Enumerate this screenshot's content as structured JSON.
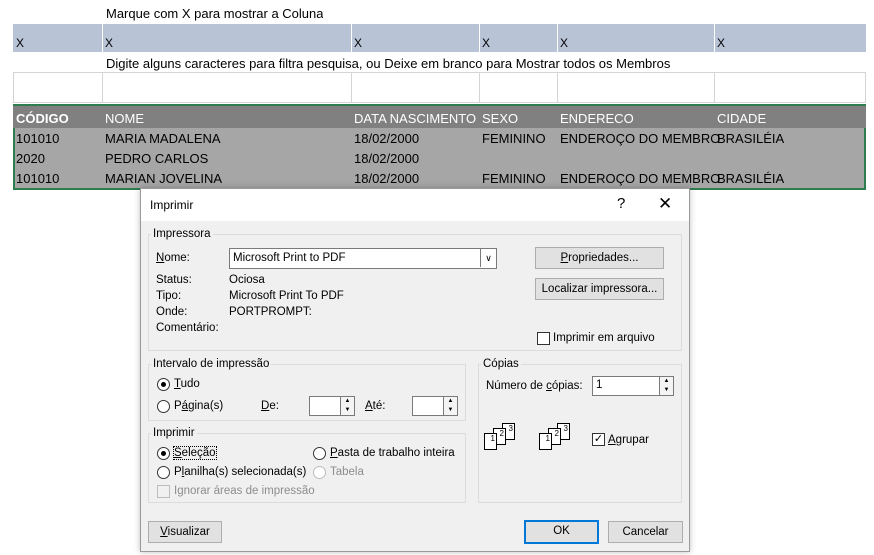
{
  "sheet": {
    "instruction_top": "Marque com X para mostrar a Coluna",
    "x_marks": [
      "X",
      "X",
      "X",
      "X",
      "X",
      "X"
    ],
    "instruction_filter": "Digite alguns caracteres para filtra pesquisa, ou Deixe em branco para Mostrar todos os Membros",
    "headers": [
      "CÓDIGO",
      "NOME",
      "DATA NASCIMENTO",
      "SEXO",
      "ENDERECO",
      "CIDADE"
    ],
    "rows": [
      [
        "101010",
        "MARIA MADALENA",
        "18/02/2000",
        "FEMININO",
        "ENDEROÇO DO MEMBRO",
        "BRASILÉIA"
      ],
      [
        "2020",
        "PEDRO CARLOS",
        "18/02/2000",
        "",
        "",
        ""
      ],
      [
        "101010",
        "MARIAN JOVELINA",
        "18/02/2000",
        "FEMININO",
        "ENDEROÇO DO MEMBRO",
        "BRASILÉIA"
      ]
    ]
  },
  "dialog": {
    "title": "Imprimir",
    "help": "?",
    "close": "✕",
    "printer": {
      "group_label": "Impressora",
      "name_label": "Nome:",
      "name_value": "Microsoft Print to PDF",
      "dropdown_arrow": "∨",
      "status_label": "Status:",
      "status_value": "Ociosa",
      "type_label": "Tipo:",
      "type_value": "Microsoft Print To PDF",
      "where_label": "Onde:",
      "where_value": "PORTPROMPT:",
      "comment_label": "Comentário:",
      "properties_button": "Propriedades...",
      "find_printer_button": "Localizar impressora...",
      "print_to_file_label": "Imprimir em arquivo"
    },
    "range": {
      "group_label": "Intervalo de impressão",
      "all_label": "Tudo",
      "pages_label": "Página(s)",
      "from_label": "De:",
      "to_label": "Até:",
      "from_value": "",
      "to_value": ""
    },
    "copies": {
      "group_label": "Cópias",
      "count_label": "Número de cópias:",
      "count_value": "1",
      "collate_label": "Agrupar",
      "collate_checked": "✓"
    },
    "print_what": {
      "group_label": "Imprimir",
      "selection_label": "Seleção",
      "whole_workbook_label": "Pasta de trabalho inteira",
      "selected_sheets_label": "Planilha(s) selecionada(s)",
      "table_label": "Tabela",
      "ignore_areas_label": "Ignorar áreas de impressão"
    },
    "buttons": {
      "preview": "Visualizar",
      "ok": "OK",
      "cancel": "Cancelar"
    }
  }
}
